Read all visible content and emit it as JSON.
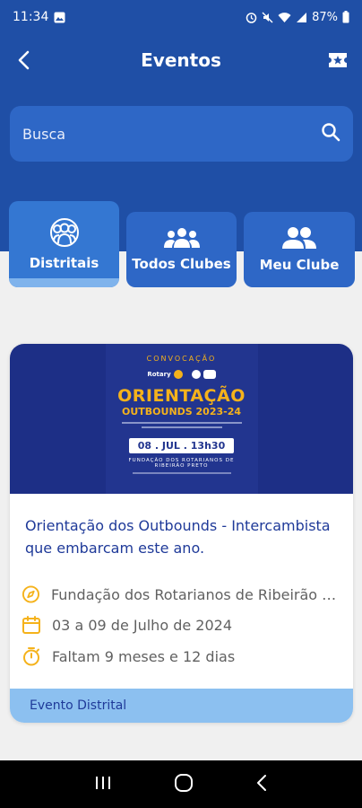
{
  "status": {
    "time": "11:34",
    "battery": "87%"
  },
  "header": {
    "title": "Eventos"
  },
  "search": {
    "placeholder": "Busca"
  },
  "tabs": [
    {
      "label": "Distritais",
      "icon": "group-circle-icon",
      "active": true
    },
    {
      "label": "Todos Clubes",
      "icon": "people-group-icon",
      "active": false
    },
    {
      "label": "Meu Clube",
      "icon": "people-pair-icon",
      "active": false
    }
  ],
  "event": {
    "poster": {
      "heading": "CONVOCAÇÃO",
      "title": "ORIENTAÇÃO",
      "subtitle": "OUTBOUNDS 2023-24",
      "date": "08 . JUL . 13h30",
      "place": "FUNDAÇÃO DOS ROTARIANOS DE RIBEIRÃO PRETO"
    },
    "title": "Orientação dos Outbounds - Intercambista que embarcam este ano.",
    "location": "Fundação dos Rotarianos de Ribeirão Preto",
    "dates": "03 a 09 de Julho de 2024",
    "countdown": "Faltam 9 meses e 12 dias",
    "category": "Evento Distrital"
  },
  "colors": {
    "primary": "#1f4fa6",
    "accent": "#f5b21b",
    "tab": "#2e67c6"
  }
}
